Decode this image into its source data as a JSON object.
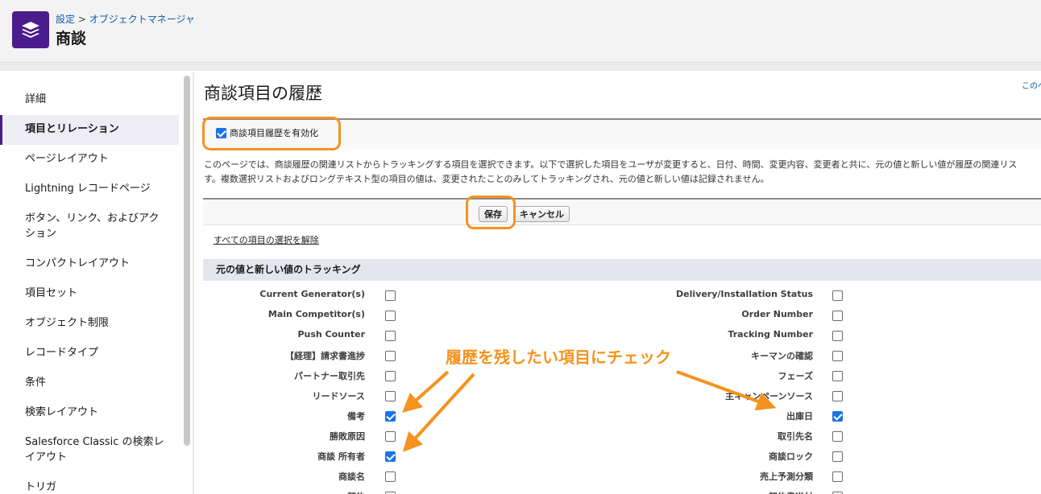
{
  "header": {
    "breadcrumb_setup": "設定",
    "breadcrumb_sep": ">",
    "breadcrumb_object_manager": "オブジェクトマネージャ",
    "title": "商談",
    "icon": "layers-icon"
  },
  "sidebar": {
    "items": [
      {
        "label": "詳細"
      },
      {
        "label": "項目とリレーション"
      },
      {
        "label": "ページレイアウト"
      },
      {
        "label": "Lightning レコードページ"
      },
      {
        "label": "ボタン、リンク、およびアク\nション"
      },
      {
        "label": "コンパクトレイアウト"
      },
      {
        "label": "項目セット"
      },
      {
        "label": "オブジェクト制限"
      },
      {
        "label": "レコードタイプ"
      },
      {
        "label": "条件"
      },
      {
        "label": "検索レイアウト"
      },
      {
        "label": "Salesforce Classic の検索レ\nイアウト"
      },
      {
        "label": "トリガ"
      }
    ]
  },
  "main": {
    "title": "商談項目の履歴",
    "help_link": "このペ",
    "enable_label": "商談項目履歴を有効化",
    "enable_checked": true,
    "description_line1": "このページでは、商談履歴の関連リストからトラッキングする項目を選択できます。以下で選択した項目をユーザが変更すると、日付、時間、変更内容、変更者と共に、元の値と新しい値が履歴の関連リス",
    "description_line2": "す。複数選択リストおよびロングテキスト型の項目の値は、変更されたことのみしてトラッキングされ、元の値と新しい値は記録されません。",
    "save_label": "保存",
    "cancel_label": "キャンセル",
    "deselect_all": "すべての項目の選択を解除",
    "section_title": "元の値と新しい値のトラッキング",
    "annotation": "履歴を残したい項目にチェック",
    "highlight_color": "#f5931e"
  },
  "fields_left": [
    {
      "label": "Current Generator(s)",
      "checked": false
    },
    {
      "label": "Main Competitor(s)",
      "checked": false
    },
    {
      "label": "Push Counter",
      "checked": false
    },
    {
      "label": "【経理】請求書進捗",
      "checked": false
    },
    {
      "label": "パートナー取引先",
      "checked": false
    },
    {
      "label": "リードソース",
      "checked": false
    },
    {
      "label": "備考",
      "checked": true
    },
    {
      "label": "勝敗原因",
      "checked": false
    },
    {
      "label": "商談 所有者",
      "checked": true
    },
    {
      "label": "商談名",
      "checked": false
    },
    {
      "label": "契約",
      "checked": false
    }
  ],
  "fields_right": [
    {
      "label": "Delivery/Installation Status",
      "checked": false
    },
    {
      "label": "Order Number",
      "checked": false
    },
    {
      "label": "Tracking Number",
      "checked": false
    },
    {
      "label": "キーマンの確認",
      "checked": false
    },
    {
      "label": "フェーズ",
      "checked": false
    },
    {
      "label": "主キャンペーンソース",
      "checked": false
    },
    {
      "label": "出庫日",
      "checked": true
    },
    {
      "label": "取引先名",
      "checked": false
    },
    {
      "label": "商談ロック",
      "checked": false
    },
    {
      "label": "売上予測分類",
      "checked": false
    },
    {
      "label": "契約書送付",
      "checked": false
    }
  ]
}
